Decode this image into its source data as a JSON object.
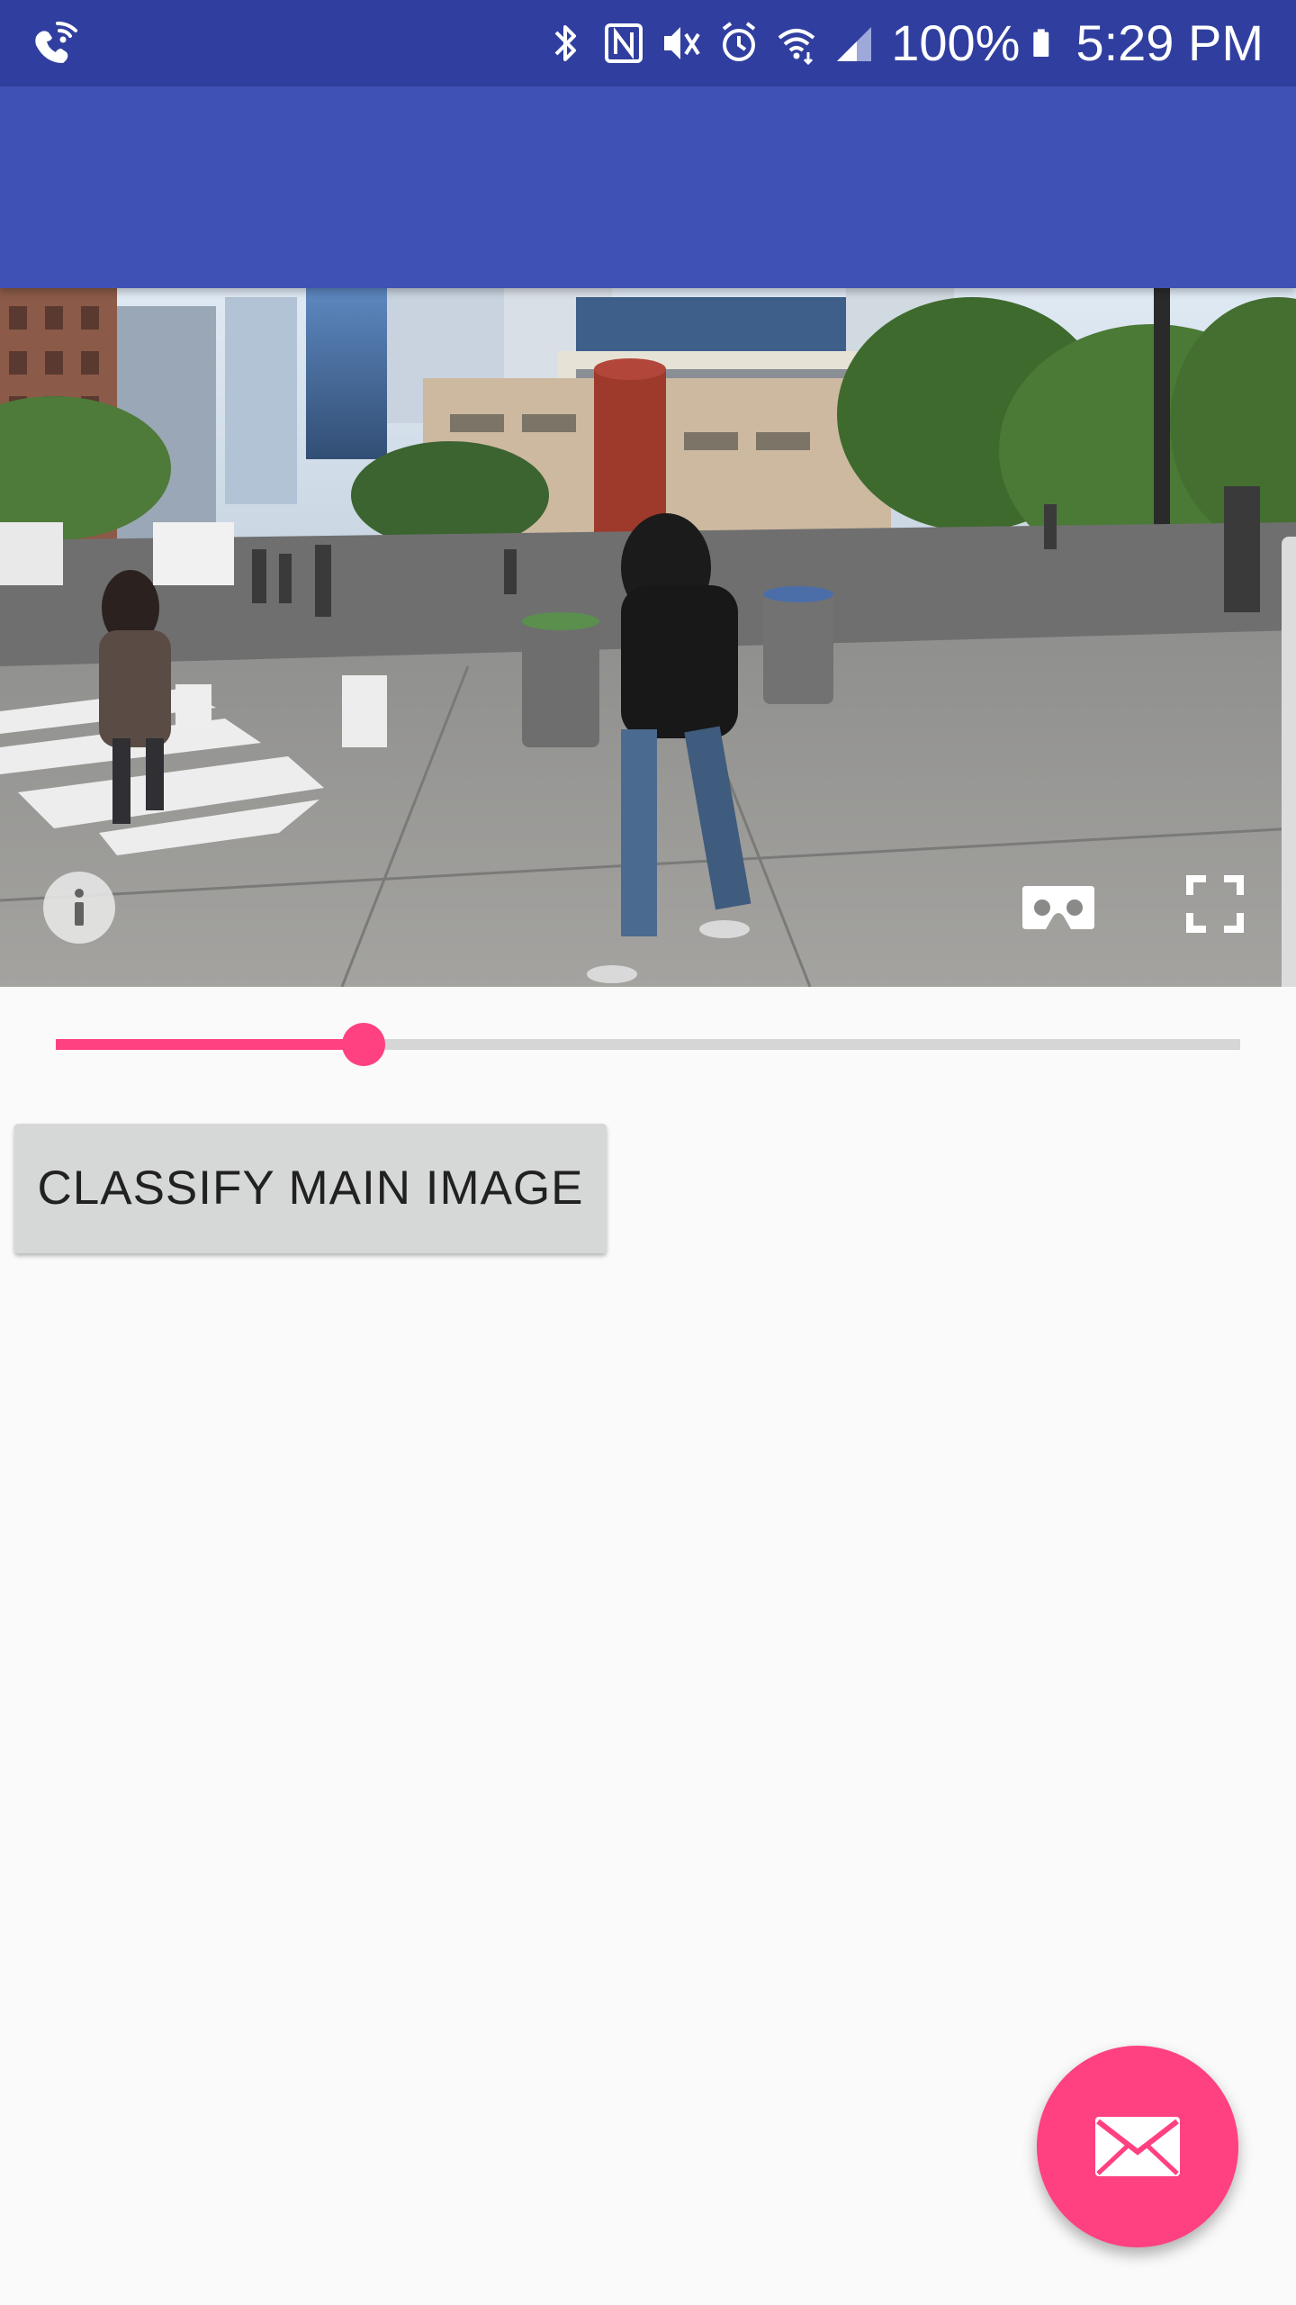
{
  "status_bar": {
    "battery_percent": "100%",
    "time": "5:29 PM",
    "icons": [
      "wifi-calling-icon",
      "bluetooth-icon",
      "nfc-icon",
      "vibrate-icon",
      "alarm-icon",
      "wifi-icon",
      "cell-signal-icon",
      "battery-icon"
    ]
  },
  "app_bar": {
    "color": "#3f51b5"
  },
  "panorama": {
    "icons": [
      "info-icon",
      "cardboard-vr-icon",
      "fullscreen-icon"
    ]
  },
  "seek_bar": {
    "progress": 0.26,
    "color": "#ff4081"
  },
  "actions": {
    "classify_label": "CLASSIFY MAIN IMAGE"
  },
  "fab": {
    "icon": "email-icon",
    "color": "#ff4081"
  }
}
